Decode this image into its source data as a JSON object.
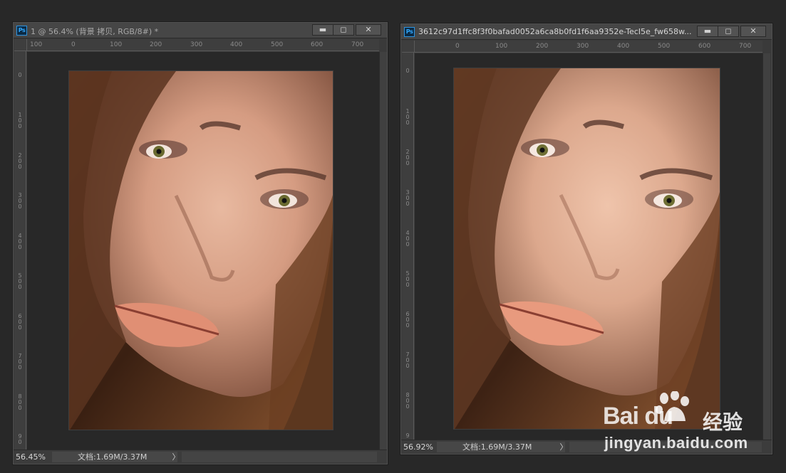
{
  "app": {
    "icon_label": "Ps"
  },
  "windows": [
    {
      "title": "1 @ 56.4% (背景 拷贝, RGB/8#) *",
      "zoom": "56.45%",
      "doc_size": "文档:1.69M/3.37M",
      "hruler": [
        "100",
        "0",
        "100",
        "200",
        "300",
        "400",
        "500",
        "600",
        "700"
      ],
      "vruler": [
        "0",
        "100",
        "200",
        "300",
        "400",
        "500",
        "600",
        "700",
        "800",
        "90"
      ],
      "controls": {
        "minimize": "▬",
        "maximize": "◻",
        "close": "✕"
      },
      "nav_arrow": "〉"
    },
    {
      "title": "3612c97d1ffc8f3f0bafad0052a6ca8b0fd1f6aa9352e-TecI5e_fw658w...",
      "zoom": "56.92%",
      "doc_size": "文档:1.69M/3.37M",
      "hruler": [
        "0",
        "100",
        "200",
        "300",
        "400",
        "500",
        "600",
        "700"
      ],
      "vruler": [
        "0",
        "100",
        "200",
        "300",
        "400",
        "500",
        "600",
        "700",
        "800",
        "9"
      ],
      "controls": {
        "minimize": "▬",
        "maximize": "◻",
        "close": "✕"
      },
      "nav_arrow": "〉"
    }
  ],
  "watermark": {
    "brand": "Bai du",
    "product": "经验",
    "url": "jingyan.baidu.com"
  },
  "colors": {
    "workspace": "#282828",
    "panel": "#3a3a3a",
    "ps_accent": "#31a8ff"
  }
}
